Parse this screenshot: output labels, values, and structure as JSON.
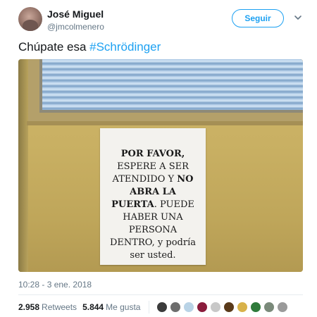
{
  "user": {
    "display_name": "José Miguel",
    "handle": "@jmcolmenero",
    "follow_label": "Seguir"
  },
  "tweet": {
    "text_prefix": "Chúpate esa ",
    "hashtag": "#Schrödinger"
  },
  "notice": {
    "line1": "POR FAVOR,",
    "line2": "ESPERE A SER",
    "line3a": "ATENDIDO Y ",
    "line3b": "NO",
    "line4": "ABRA LA",
    "line5a": "PUERTA",
    "line5b": ". PUEDE",
    "line6": "HABER UNA",
    "line7": "PERSONA",
    "line8": "DENTRO, y podría",
    "line9": "ser usted."
  },
  "meta": {
    "timestamp": "10:28 - 3 ene. 2018"
  },
  "stats": {
    "retweets_count": "2.958",
    "retweets_label": "Retweets",
    "likes_count": "5.844",
    "likes_label": "Me gusta"
  },
  "liker_colors": [
    "#3b3b3b",
    "#6d6d6d",
    "#b9d3e6",
    "#8a1c3c",
    "#c8c8c8",
    "#5a3a1a",
    "#d8b24a",
    "#2f7a3a",
    "#7a8a7a",
    "#9a9a9a"
  ],
  "colors": {
    "accent": "#1da1f2",
    "text": "#14171a",
    "muted": "#657786"
  }
}
